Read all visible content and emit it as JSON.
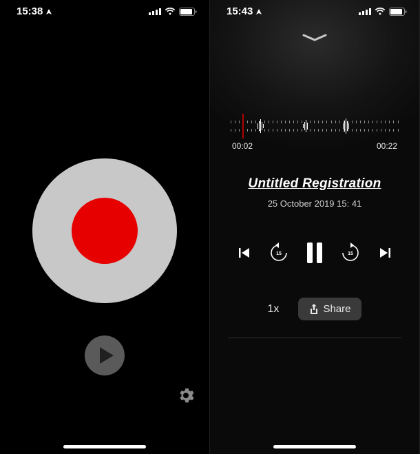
{
  "left": {
    "status": {
      "time": "15:38"
    }
  },
  "right": {
    "status": {
      "time": "15:43"
    },
    "waveform": {
      "current": "00:02",
      "total": "00:22"
    },
    "recording": {
      "title": "Untitled Registration",
      "date": "25 October 2019 15: 41"
    },
    "controls": {
      "rewind_seconds": "15",
      "forward_seconds": "15",
      "speed": "1x",
      "share": "Share"
    }
  }
}
